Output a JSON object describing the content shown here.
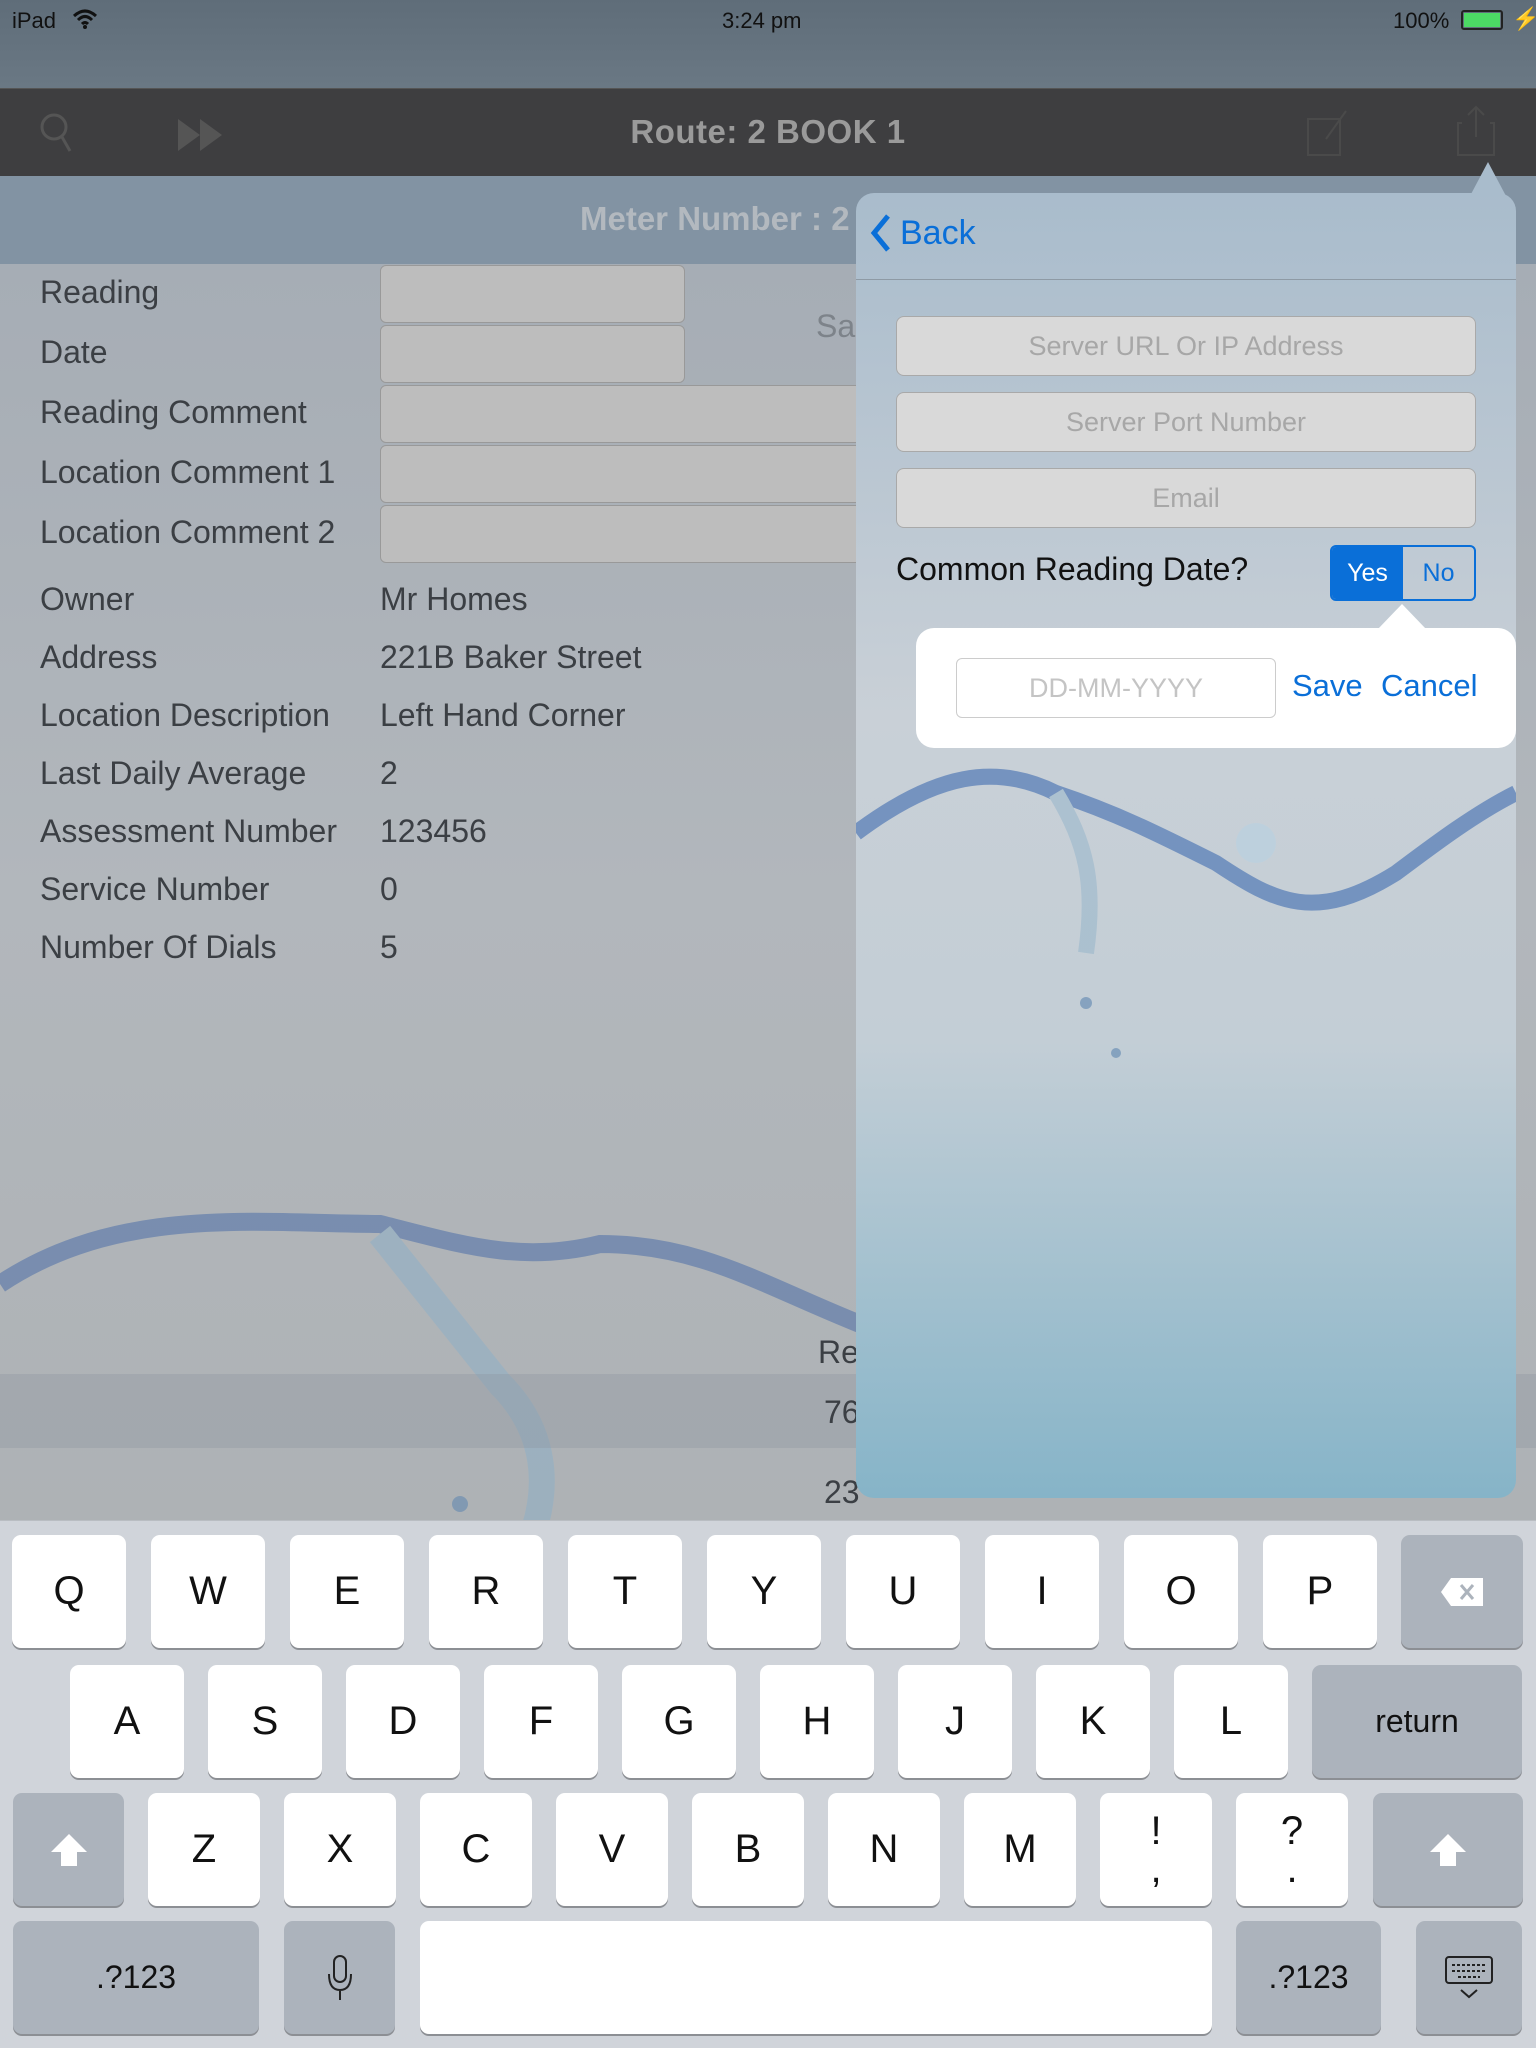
{
  "status": {
    "device": "iPad",
    "time": "3:24 pm",
    "battery": "100%",
    "battery_color": "#4cd964"
  },
  "toolbar": {
    "title": "Route:  2  BOOK 1",
    "icons": [
      "search-icon",
      "fast-forward-icon",
      "edit-icon",
      "share-icon"
    ]
  },
  "meter": {
    "label": "Meter Number :  2"
  },
  "form": {
    "fields": [
      {
        "label": "Reading"
      },
      {
        "label": "Date"
      },
      {
        "label": "Reading Comment"
      },
      {
        "label": "Location Comment 1"
      },
      {
        "label": "Location Comment 2"
      }
    ],
    "details": [
      {
        "label": "Owner",
        "value": "Mr Homes"
      },
      {
        "label": "Address",
        "value": "221B Baker Street"
      },
      {
        "label": "Location Description",
        "value": "Left Hand Corner"
      },
      {
        "label": "Last Daily Average",
        "value": "2"
      },
      {
        "label": "Assessment Number",
        "value": "123456"
      },
      {
        "label": "Service Number",
        "value": "0"
      },
      {
        "label": "Number Of Dials",
        "value": "5"
      }
    ],
    "save_fragment": "Sa",
    "table_header_fragment": "Re",
    "row1_fragment": "76",
    "row2_fragment": "23"
  },
  "popover": {
    "back_label": "Back",
    "server_url_placeholder": "Server URL Or IP Address",
    "server_port_placeholder": "Server Port Number",
    "email_placeholder": "Email",
    "common_reading_date_label": "Common Reading Date?",
    "yes_label": "Yes",
    "no_label": "No",
    "selected": "Yes",
    "accent": "#0a6fd8"
  },
  "date_popup": {
    "placeholder": "DD-MM-YYYY",
    "save_label": "Save",
    "cancel_label": "Cancel"
  },
  "keyboard": {
    "row1": [
      "Q",
      "W",
      "E",
      "R",
      "T",
      "Y",
      "U",
      "I",
      "O",
      "P"
    ],
    "row2": [
      "A",
      "S",
      "D",
      "F",
      "G",
      "H",
      "J",
      "K",
      "L"
    ],
    "row3": [
      "Z",
      "X",
      "C",
      "V",
      "B",
      "N",
      "M",
      "!\n,",
      "?\n."
    ],
    "return_label": "return",
    "numbers_label": ".?123"
  }
}
